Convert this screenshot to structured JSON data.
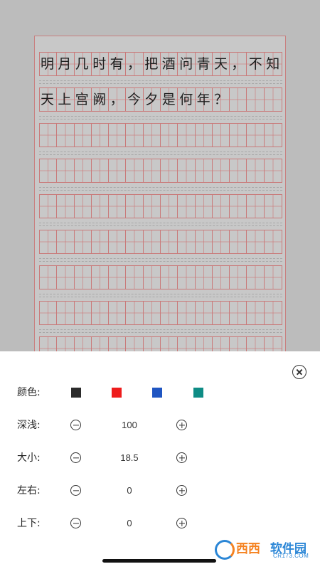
{
  "paper": {
    "lines": [
      "明月几时有，把酒问青天，不知",
      "天上宫阙，今夕是何年？"
    ],
    "text_color": "#1e1e1e",
    "grid_color": "#c97a7a"
  },
  "settings": {
    "color": {
      "label": "颜色:",
      "swatches": [
        {
          "name": "black",
          "hex": "#2b2b2b"
        },
        {
          "name": "red",
          "hex": "#ee1c1c"
        },
        {
          "name": "blue",
          "hex": "#1f55c2"
        },
        {
          "name": "teal",
          "hex": "#0e8c85"
        }
      ]
    },
    "depth": {
      "label": "深浅:",
      "value": "100"
    },
    "size": {
      "label": "大小:",
      "value": "18.5"
    },
    "horizontal": {
      "label": "左右:",
      "value": "0"
    },
    "vertical": {
      "label": "上下:",
      "value": "0"
    }
  },
  "watermark": {
    "brand_cn": "西西",
    "brand_tail": "软件园",
    "domain": "CR173.COM"
  },
  "icons": {
    "close": "close-circle-icon",
    "minus": "minus-circle-icon",
    "plus": "plus-circle-icon"
  }
}
